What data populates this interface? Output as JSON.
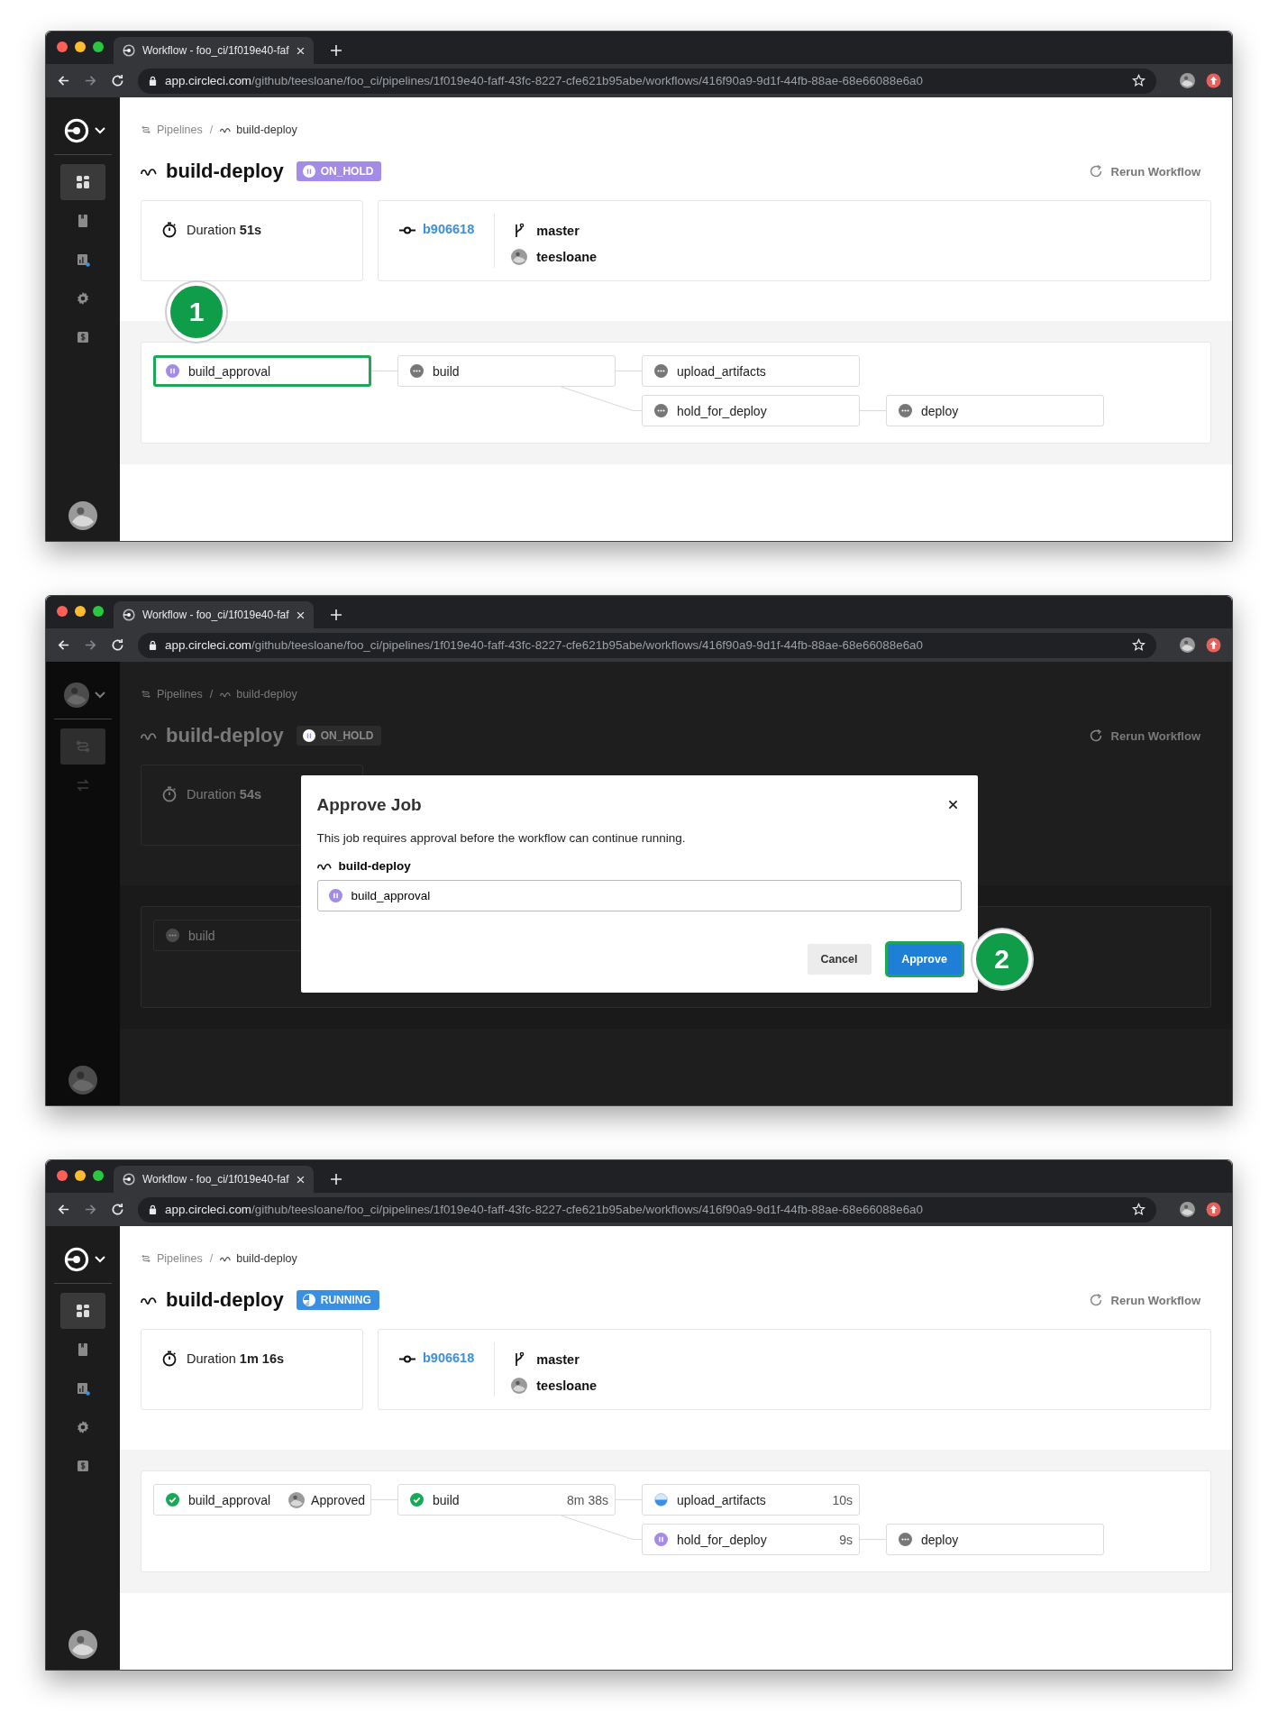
{
  "windows": [
    {
      "tab_title": "Workflow - foo_ci/1f019e40-faf",
      "url_host": "app.circleci.com",
      "url_path": "/github/teesloane/foo_ci/pipelines/1f019e40-faff-43fc-8227-cfe621b95abe/workflows/416f90a9-9d1f-44fb-88ae-68e66088e6a0",
      "sidebar": {
        "org": {
          "kind": "logo"
        },
        "items": [
          {
            "kind": "dashboard",
            "selected": true
          },
          {
            "kind": "projects",
            "selected": false
          },
          {
            "kind": "insights",
            "selected": false
          },
          {
            "kind": "settings",
            "selected": false
          },
          {
            "kind": "plan",
            "selected": false
          }
        ]
      },
      "dimmed": false,
      "breadcrumb": [
        {
          "label": "Pipelines",
          "kind": "pipelines"
        },
        {
          "label": "build-deploy",
          "kind": "workflow"
        }
      ],
      "breadcrumb_separator": "/",
      "title": "build-deploy",
      "status": {
        "label": "ON_HOLD",
        "kind": "on_hold"
      },
      "rerun": "Rerun Workflow",
      "duration": {
        "label": "Duration",
        "value": "51s"
      },
      "commit": {
        "hash": "b906618",
        "branch": "master",
        "author": "teesloane"
      },
      "jobs": [
        {
          "name": "build_approval",
          "kind": "on_hold",
          "highlighted": true,
          "callout": "1",
          "children": [
            {
              "name": "build",
              "kind": "blocked",
              "highlighted": false,
              "children": [
                {
                  "name": "upload_artifacts",
                  "kind": "blocked",
                  "highlighted": false
                },
                {
                  "name": "hold_for_deploy",
                  "kind": "blocked",
                  "highlighted": false,
                  "children": [
                    {
                      "name": "deploy",
                      "kind": "blocked",
                      "highlighted": false
                    }
                  ]
                }
              ]
            }
          ]
        }
      ]
    },
    {
      "tab_title": "Workflow - foo_ci/1f019e40-faf",
      "url_host": "app.circleci.com",
      "url_path": "/github/teesloane/foo_ci/pipelines/1f019e40-faff-43fc-8227-cfe621b95abe/workflows/416f90a9-9d1f-44fb-88ae-68e66088e6a0",
      "sidebar": {
        "org": {
          "kind": "avatar"
        },
        "items": [
          {
            "kind": "pipelines",
            "selected": true
          },
          {
            "kind": "swap",
            "selected": false
          }
        ]
      },
      "dimmed": true,
      "breadcrumb": [
        {
          "label": "Pipelines",
          "kind": "pipelines"
        },
        {
          "label": "build-deploy",
          "kind": "workflow"
        }
      ],
      "breadcrumb_separator": "/",
      "title": "build-deploy",
      "status": {
        "label": "ON_HOLD",
        "kind": "on_hold"
      },
      "rerun": "Rerun Workflow",
      "duration": {
        "label": "Duration",
        "value": "54s"
      },
      "jobs": [
        {
          "name": "build",
          "kind": "blocked",
          "highlighted": false
        }
      ],
      "modal": {
        "title": "Approve Job",
        "message": "This job requires approval before the workflow can continue running.",
        "workflow": "build-deploy",
        "job": {
          "name": "build_approval",
          "kind": "on_hold"
        },
        "buttons": [
          {
            "label": "Cancel",
            "kind": "secondary",
            "highlighted": false
          },
          {
            "label": "Approve",
            "kind": "primary",
            "highlighted": true,
            "callout": "2"
          }
        ]
      }
    },
    {
      "tab_title": "Workflow - foo_ci/1f019e40-faf",
      "url_host": "app.circleci.com",
      "url_path": "/github/teesloane/foo_ci/pipelines/1f019e40-faff-43fc-8227-cfe621b95abe/workflows/416f90a9-9d1f-44fb-88ae-68e66088e6a0",
      "sidebar": {
        "org": {
          "kind": "logo"
        },
        "items": [
          {
            "kind": "dashboard",
            "selected": true
          },
          {
            "kind": "projects",
            "selected": false
          },
          {
            "kind": "insights",
            "selected": false
          },
          {
            "kind": "settings",
            "selected": false
          },
          {
            "kind": "plan",
            "selected": false
          }
        ]
      },
      "dimmed": false,
      "breadcrumb": [
        {
          "label": "Pipelines",
          "kind": "pipelines"
        },
        {
          "label": "build-deploy",
          "kind": "workflow"
        }
      ],
      "breadcrumb_separator": "/",
      "title": "build-deploy",
      "status": {
        "label": "RUNNING",
        "kind": "running"
      },
      "rerun": "Rerun Workflow",
      "duration": {
        "label": "Duration",
        "value": "1m 16s"
      },
      "commit": {
        "hash": "b906618",
        "branch": "master",
        "author": "teesloane"
      },
      "jobs": [
        {
          "name": "build_approval",
          "kind": "success",
          "highlighted": false,
          "approval": "Approved",
          "children": [
            {
              "name": "build",
              "kind": "success",
              "highlighted": false,
              "duration": "8m 38s",
              "children": [
                {
                  "name": "upload_artifacts",
                  "kind": "running",
                  "highlighted": false,
                  "duration": "10s"
                },
                {
                  "name": "hold_for_deploy",
                  "kind": "on_hold",
                  "highlighted": false,
                  "duration": "9s",
                  "children": [
                    {
                      "name": "deploy",
                      "kind": "blocked",
                      "highlighted": false
                    }
                  ]
                }
              ]
            }
          ]
        }
      ]
    }
  ]
}
